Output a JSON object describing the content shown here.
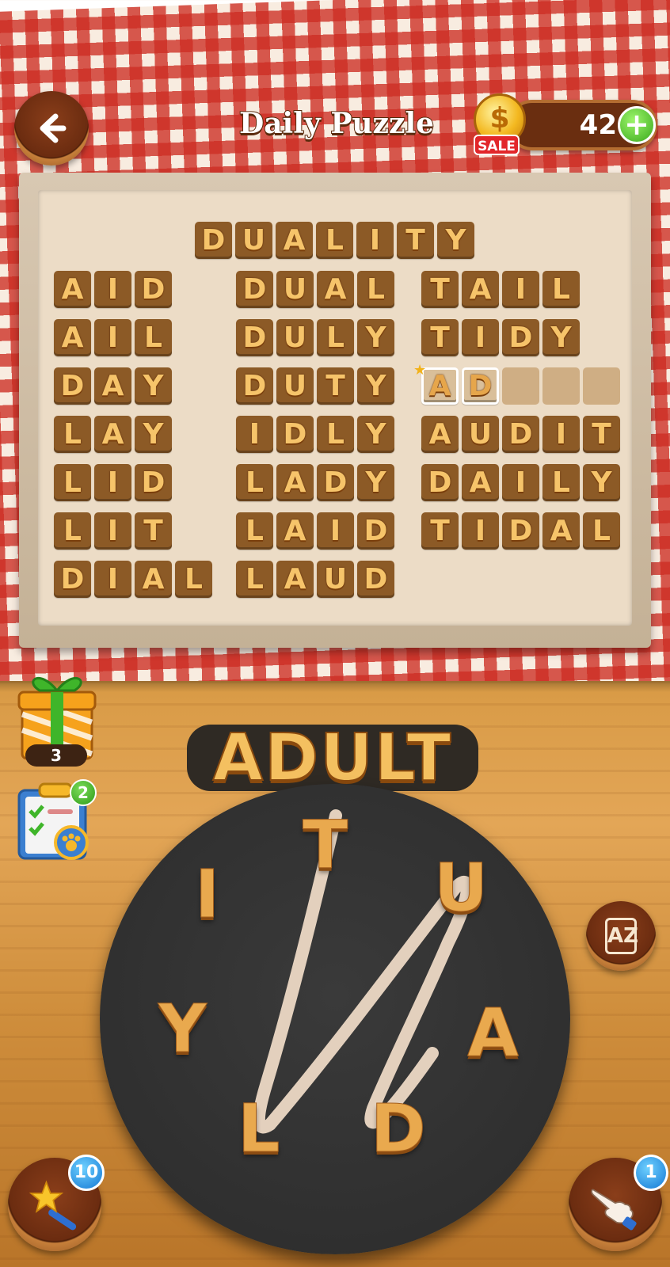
{
  "header": {
    "title": "Daily Puzzle",
    "coins": "42",
    "coin_symbol": "$",
    "sale_label": "SALE",
    "plus_label": "+"
  },
  "board": {
    "words": [
      {
        "text": "DUALITY",
        "state": "found"
      },
      {
        "text": "AID",
        "state": "found"
      },
      {
        "text": "AIL",
        "state": "found"
      },
      {
        "text": "DAY",
        "state": "found"
      },
      {
        "text": "LAY",
        "state": "found"
      },
      {
        "text": "LID",
        "state": "found"
      },
      {
        "text": "LIT",
        "state": "found"
      },
      {
        "text": "DIAL",
        "state": "found"
      },
      {
        "text": "DUAL",
        "state": "found"
      },
      {
        "text": "DULY",
        "state": "found"
      },
      {
        "text": "DUTY",
        "state": "found"
      },
      {
        "text": "IDLY",
        "state": "found"
      },
      {
        "text": "LADY",
        "state": "found"
      },
      {
        "text": "LAID",
        "state": "found"
      },
      {
        "text": "LAUD",
        "state": "found"
      },
      {
        "text": "TAIL",
        "state": "found"
      },
      {
        "text": "TIDY",
        "state": "found"
      },
      {
        "text": "AD",
        "state": "partial",
        "length": 5
      },
      {
        "text": "AUDIT",
        "state": "found"
      },
      {
        "text": "DAILY",
        "state": "found"
      },
      {
        "text": "TIDAL",
        "state": "found"
      }
    ]
  },
  "left_tools": {
    "gift_count": "3",
    "tasks_badge": "2"
  },
  "current_word": "ADULT",
  "wheel": {
    "letters": [
      "T",
      "U",
      "A",
      "D",
      "L",
      "Y",
      "I"
    ]
  },
  "shuffle_label": "AZ",
  "boosters": {
    "magic_count": "10",
    "finger_count": "1"
  }
}
